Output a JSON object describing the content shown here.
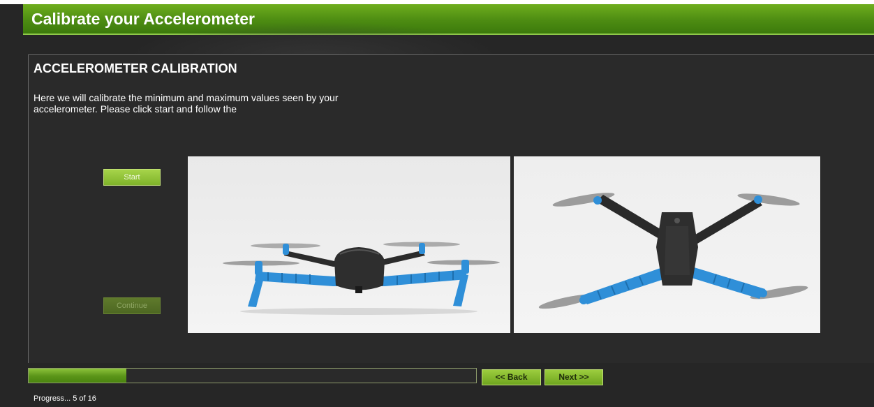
{
  "header": {
    "title": "Calibrate your Accelerometer"
  },
  "panel": {
    "section_title": "ACCELEROMETER CALIBRATION",
    "description": "Here we will calibrate the minimum and maximum values seen by your accelerometer. Please click start and follow the",
    "start_label": "Start",
    "continue_label": "Continue"
  },
  "images": {
    "side_view": "drone-side-view",
    "top_view": "drone-top-view"
  },
  "progress": {
    "current": 5,
    "total": 16,
    "fraction": 0.3125,
    "label": "Progress... 5 of 16"
  },
  "nav": {
    "back_label": "<< Back",
    "next_label": "Next >>"
  },
  "colors": {
    "accent_green": "#5a9418",
    "background": "#262626",
    "drone_arm_blue": "#2f8fd8"
  }
}
